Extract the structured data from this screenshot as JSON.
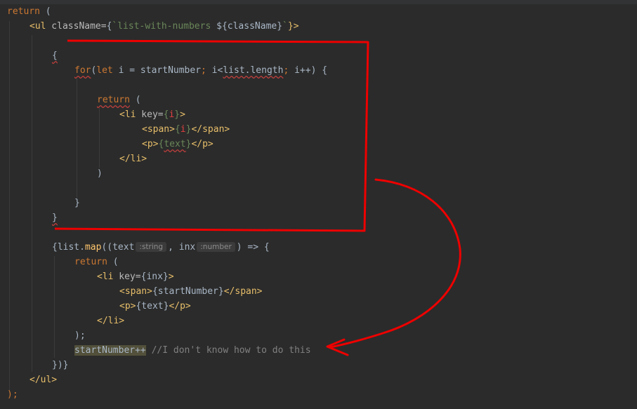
{
  "code": {
    "l1_return": "return",
    "l1_paren": " (",
    "l2_open": "<ul",
    "l2_attr": " className=",
    "l2_brace_open": "{",
    "l2_tmpl": "`list-with-numbers ",
    "l2_interp": "${className}",
    "l2_tmpl_end": "`",
    "l2_close": "}>",
    "l3_brace": "{",
    "l4_for": "for",
    "l4_open": "(",
    "l4_let": "let",
    "l4_init": " i = startNumber",
    "l4_semi1": ";",
    "l4_cond_a": " i<",
    "l4_cond_b": "list.length",
    "l4_semi2": ";",
    "l4_inc": " i++) {",
    "l5_return": "return",
    "l5_paren": " (",
    "l6_li": "<li",
    "l6_key": " key=",
    "l6_brace_open": "{",
    "l6_i": "i",
    "l6_brace_close": "}",
    "l6_end": ">",
    "l7_span": "<span>",
    "l7_brace_open": "{",
    "l7_i": "i",
    "l7_brace_close": "}",
    "l7_span_close": "</span>",
    "l8_p": "<p>",
    "l8_brace_open": "{",
    "l8_text": "text",
    "l8_brace_close": "}",
    "l8_p_close": "</p>",
    "l9_li_close": "</li>",
    "l10_paren": ")",
    "l11_brace": "}",
    "l12_brace": "}",
    "l13_pre": "{list.",
    "l13_map": "map",
    "l13_args": "((text",
    "l13_hint_text": ":string",
    "l13_comma": ", inx",
    "l13_hint_inx": ":number",
    "l13_arrow": ") => {",
    "l14_return": "return",
    "l14_paren": " (",
    "l15_li": "<li",
    "l15_key": " key=",
    "l15_val": "{inx}",
    "l15_end": ">",
    "l16_span": "<span>",
    "l16_val": "{startNumber}",
    "l16_span_close": "</span>",
    "l17_p": "<p>",
    "l17_val": "{text}",
    "l17_p_close": "</p>",
    "l18_li_close": "</li>",
    "l19_close": ");",
    "l20_stmt": "startNumber++",
    "l20_comment": " //I don't know how to do this",
    "l21_close": "})}",
    "l22_ul_close": "</ul>",
    "l23_close": ");"
  },
  "colors": {
    "background": "#2b2b2b",
    "keyword": "#cc7832",
    "tag": "#e8bf6a",
    "string": "#6a8759",
    "comment": "#808080",
    "annotation": "#ee0000"
  }
}
